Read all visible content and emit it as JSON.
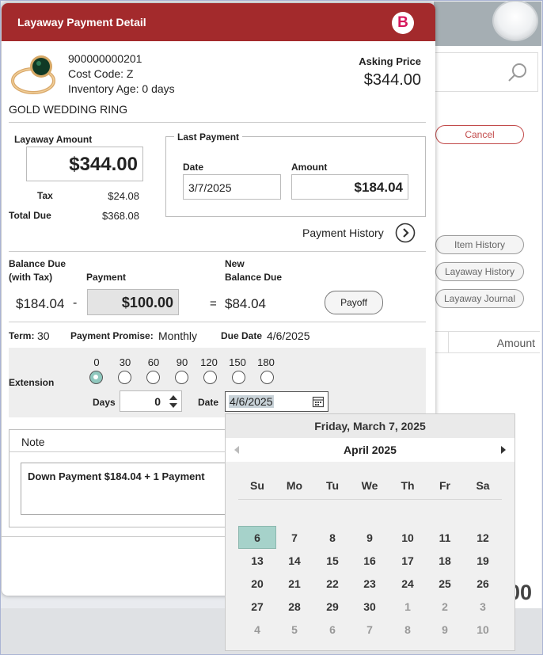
{
  "dialog": {
    "title": "Layaway Payment Detail",
    "logo_letter": "B",
    "item": {
      "number": "900000000201",
      "cost_code": "Cost Code: Z",
      "inventory_age": "Inventory Age: 0 days",
      "description": "GOLD WEDDING RING",
      "asking_price_label": "Asking Price",
      "asking_price": "$344.00"
    },
    "layaway": {
      "amount_label": "Layaway Amount",
      "amount": "$344.00",
      "tax_label": "Tax",
      "tax": "$24.08",
      "total_due_label": "Total Due",
      "total_due": "$368.08"
    },
    "last_payment": {
      "label": "Last Payment",
      "date_label": "Date",
      "date": "3/7/2025",
      "amount_label": "Amount",
      "amount": "$184.04"
    },
    "payment_history_label": "Payment History",
    "balance": {
      "balance_due_label_1": "Balance Due",
      "balance_due_label_2": "(with Tax)",
      "balance_due": "$184.04",
      "minus": "-",
      "payment_label": "Payment",
      "payment": "$100.00",
      "equals": "=",
      "new_balance_label_1": "New",
      "new_balance_label_2": "Balance Due",
      "new_balance": "$84.04",
      "payoff_label": "Payoff"
    },
    "terms": {
      "term_label": "Term:",
      "term": "30",
      "promise_label": "Payment Promise:",
      "promise": "Monthly",
      "due_label": "Due Date",
      "due": "4/6/2025"
    },
    "extension": {
      "label": "Extension",
      "options": [
        "0",
        "30",
        "60",
        "90",
        "120",
        "150",
        "180"
      ],
      "selected": "0",
      "days_label": "Days",
      "days": "0",
      "date_label": "Date",
      "date": "4/6/2025"
    },
    "note": {
      "header": "Note",
      "text": "Down Payment $184.04 + 1 Payment"
    }
  },
  "background": {
    "cancel_label": "Cancel",
    "item_history_label": "Item History",
    "layaway_history_label": "Layaway History",
    "layaway_journal_label": "Layaway Journal",
    "amount_header": "Amount",
    "big_text": "00"
  },
  "calendar": {
    "today_header": "Friday, March 7, 2025",
    "month": "April 2025",
    "weekdays": [
      "Su",
      "Mo",
      "Tu",
      "We",
      "Th",
      "Fr",
      "Sa"
    ],
    "weeks": [
      [
        "6",
        "7",
        "8",
        "9",
        "10",
        "11",
        "12"
      ],
      [
        "13",
        "14",
        "15",
        "16",
        "17",
        "18",
        "19"
      ],
      [
        "20",
        "21",
        "22",
        "23",
        "24",
        "25",
        "26"
      ],
      [
        "27",
        "28",
        "29",
        "30",
        "1",
        "2",
        "3"
      ],
      [
        "4",
        "5",
        "6",
        "7",
        "8",
        "9",
        "10"
      ]
    ],
    "selected_day": "6"
  },
  "colors": {
    "title_bar": "#a32a2c",
    "cancel": "#b03030",
    "selected_day": "#a6d2ca",
    "selected_radio": "#8fc8be"
  }
}
